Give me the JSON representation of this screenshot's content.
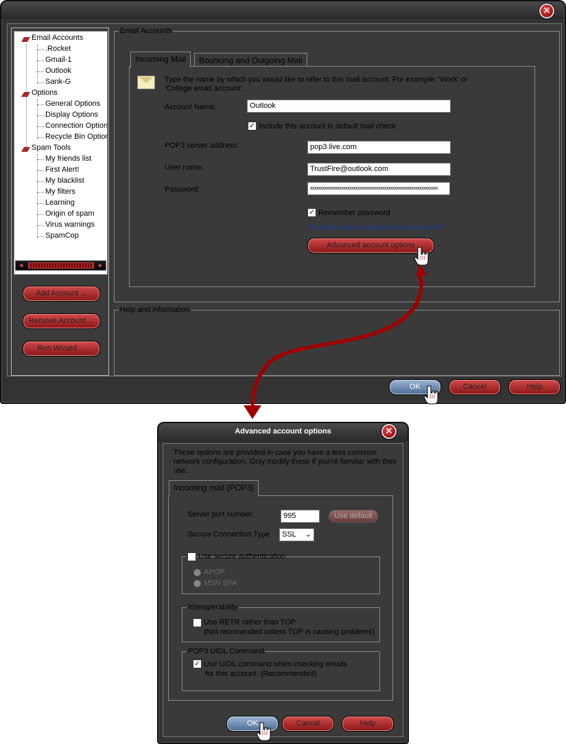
{
  "main_window": {
    "close_glyph": "✕",
    "tree": {
      "email_accounts": "Email Accounts",
      "accounts": [
        ".Rocket",
        "Gmail-1",
        "Outlook",
        "Sank-G"
      ],
      "options": "Options",
      "option_items": [
        "General Options",
        "Display Options",
        "Connection Options",
        "Recycle Bin Options"
      ],
      "spam_tools": "Spam Tools",
      "spam_items": [
        "My friends list",
        "First Alert!",
        "My blacklist",
        "My filters",
        "Learning",
        "Origin of spam",
        "Virus warnings",
        "SpamCop"
      ]
    },
    "side_buttons": {
      "add_account": "Add Account ...",
      "remove_account": "Remove Account ...",
      "run_wizard": "Run Wizard ..."
    },
    "email_accounts_group": "Email Accounts",
    "tabs": {
      "incoming": "Incoming Mail",
      "bouncing": "Bouncing and Outgoing Mail"
    },
    "intro_line1": "Type the name by which you would like to refer to this mail account. For example: 'Work' or",
    "intro_line2": "'College email account'.",
    "account_name_label": "Account Name:",
    "account_name_value": "Outlook",
    "include_default_check": "Include this account in default mail check",
    "include_default_checked": true,
    "pop3_label": "POP3 server address:",
    "pop3_value": "pop3.live.com",
    "username_label": "User name:",
    "username_value": "TrustFire@outlook.com",
    "password_label": "Password:",
    "password_value": "xxxxxxxxxxxxxxxxxxxxxxxxxxxxxxxxxxxxxxxxxxxxxxxxxxxxxxxxxxxxxx",
    "remember_password": "Remember password",
    "remember_checked": true,
    "forgotten_link": "Forgotten your email account password?",
    "advanced_button": "Advanced account options",
    "help_group": "Help and information",
    "ok": "OK",
    "cancel": "Cancel",
    "help": "Help"
  },
  "dialog": {
    "title": "Advanced account options",
    "close_glyph": "✕",
    "desc_line1": "These options are provided in case you have a less common",
    "desc_line2": "network configuration. Only modify these if you're familiar with their",
    "desc_line3": "use.",
    "tab": "Incoming mail (POP3)",
    "server_port_label": "Server port number:",
    "server_port_value": "995",
    "use_default": "Use default",
    "secure_type_label": "Secure Connection Type",
    "secure_type_value": "SSL",
    "use_secure_auth": "Use secure authentication",
    "use_secure_auth_checked": false,
    "apop": "APOP",
    "msn_spa": "MSN SPA",
    "interop_group": "Interoperability",
    "use_retr": "Use RETR rather than TOP",
    "use_retr_checked": false,
    "use_retr_note": "(Not recomended unless TOP is causing problems)",
    "uidl_group": "POP3 UIDL Command",
    "use_uidl_line1": "Use UIDL command when checking emails",
    "use_uidl_line2": "for this account. (Recommended)",
    "use_uidl_checked": true,
    "ok": "OK",
    "cancel": "Cancel",
    "help": "Help"
  },
  "colors": {
    "window_bg": "#333333",
    "button_red": "#b83030",
    "button_blue": "#6a88b0",
    "arrow_red": "#a00000"
  }
}
